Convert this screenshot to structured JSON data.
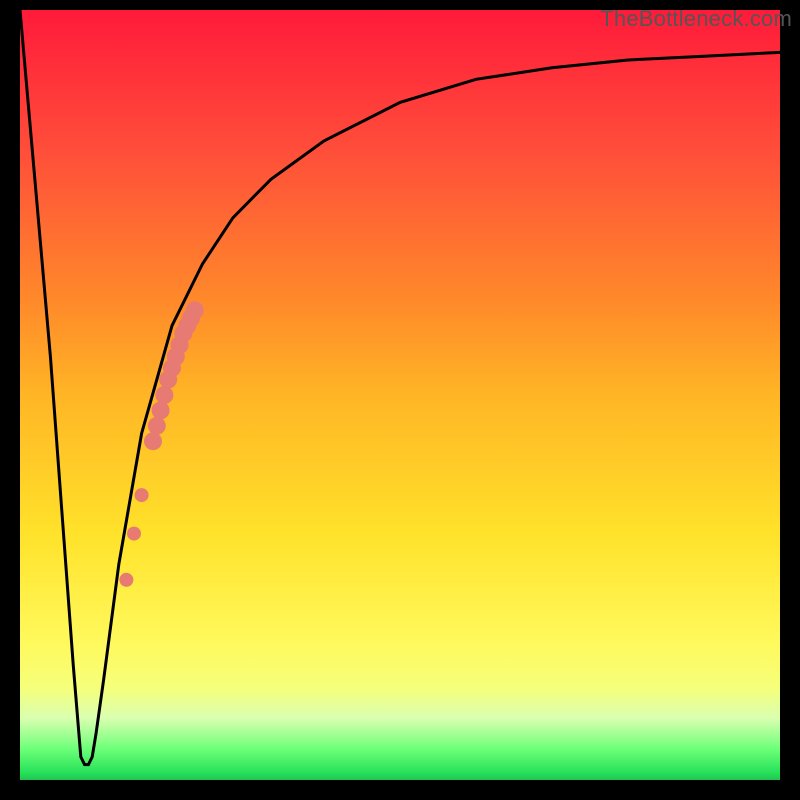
{
  "watermark": "TheBottleneck.com",
  "colors": {
    "frame": "#000000",
    "curve": "#000000",
    "dot": "#e77a73",
    "watermark": "#555555"
  },
  "chart_data": {
    "type": "line",
    "title": "",
    "xlabel": "",
    "ylabel": "",
    "xlim": [
      0,
      100
    ],
    "ylim": [
      0,
      100
    ],
    "grid": false,
    "curve": {
      "x": [
        0,
        4,
        7,
        8,
        8.5,
        9,
        9.5,
        10,
        11,
        13,
        16,
        20,
        24,
        28,
        33,
        40,
        50,
        60,
        70,
        80,
        90,
        100
      ],
      "y": [
        100,
        55,
        15,
        3,
        2,
        2,
        3,
        6,
        13,
        28,
        45,
        59,
        67,
        73,
        78,
        83,
        88,
        91,
        92.5,
        93.5,
        94,
        94.5
      ]
    },
    "dots_series": {
      "name": "highlighted segment",
      "color": "#e77a73",
      "points": [
        {
          "x": 14.0,
          "y": 26.0
        },
        {
          "x": 15.0,
          "y": 32.0
        },
        {
          "x": 16.0,
          "y": 37.0
        },
        {
          "x": 17.5,
          "y": 44.0
        },
        {
          "x": 18.0,
          "y": 46.0
        },
        {
          "x": 18.5,
          "y": 48.0
        },
        {
          "x": 19.0,
          "y": 50.0
        },
        {
          "x": 19.5,
          "y": 52.0
        },
        {
          "x": 20.0,
          "y": 53.5
        },
        {
          "x": 20.5,
          "y": 55.0
        },
        {
          "x": 21.0,
          "y": 56.5
        },
        {
          "x": 21.5,
          "y": 58.0
        },
        {
          "x": 22.0,
          "y": 59.0
        },
        {
          "x": 22.5,
          "y": 60.0
        },
        {
          "x": 23.0,
          "y": 61.0
        }
      ]
    }
  }
}
